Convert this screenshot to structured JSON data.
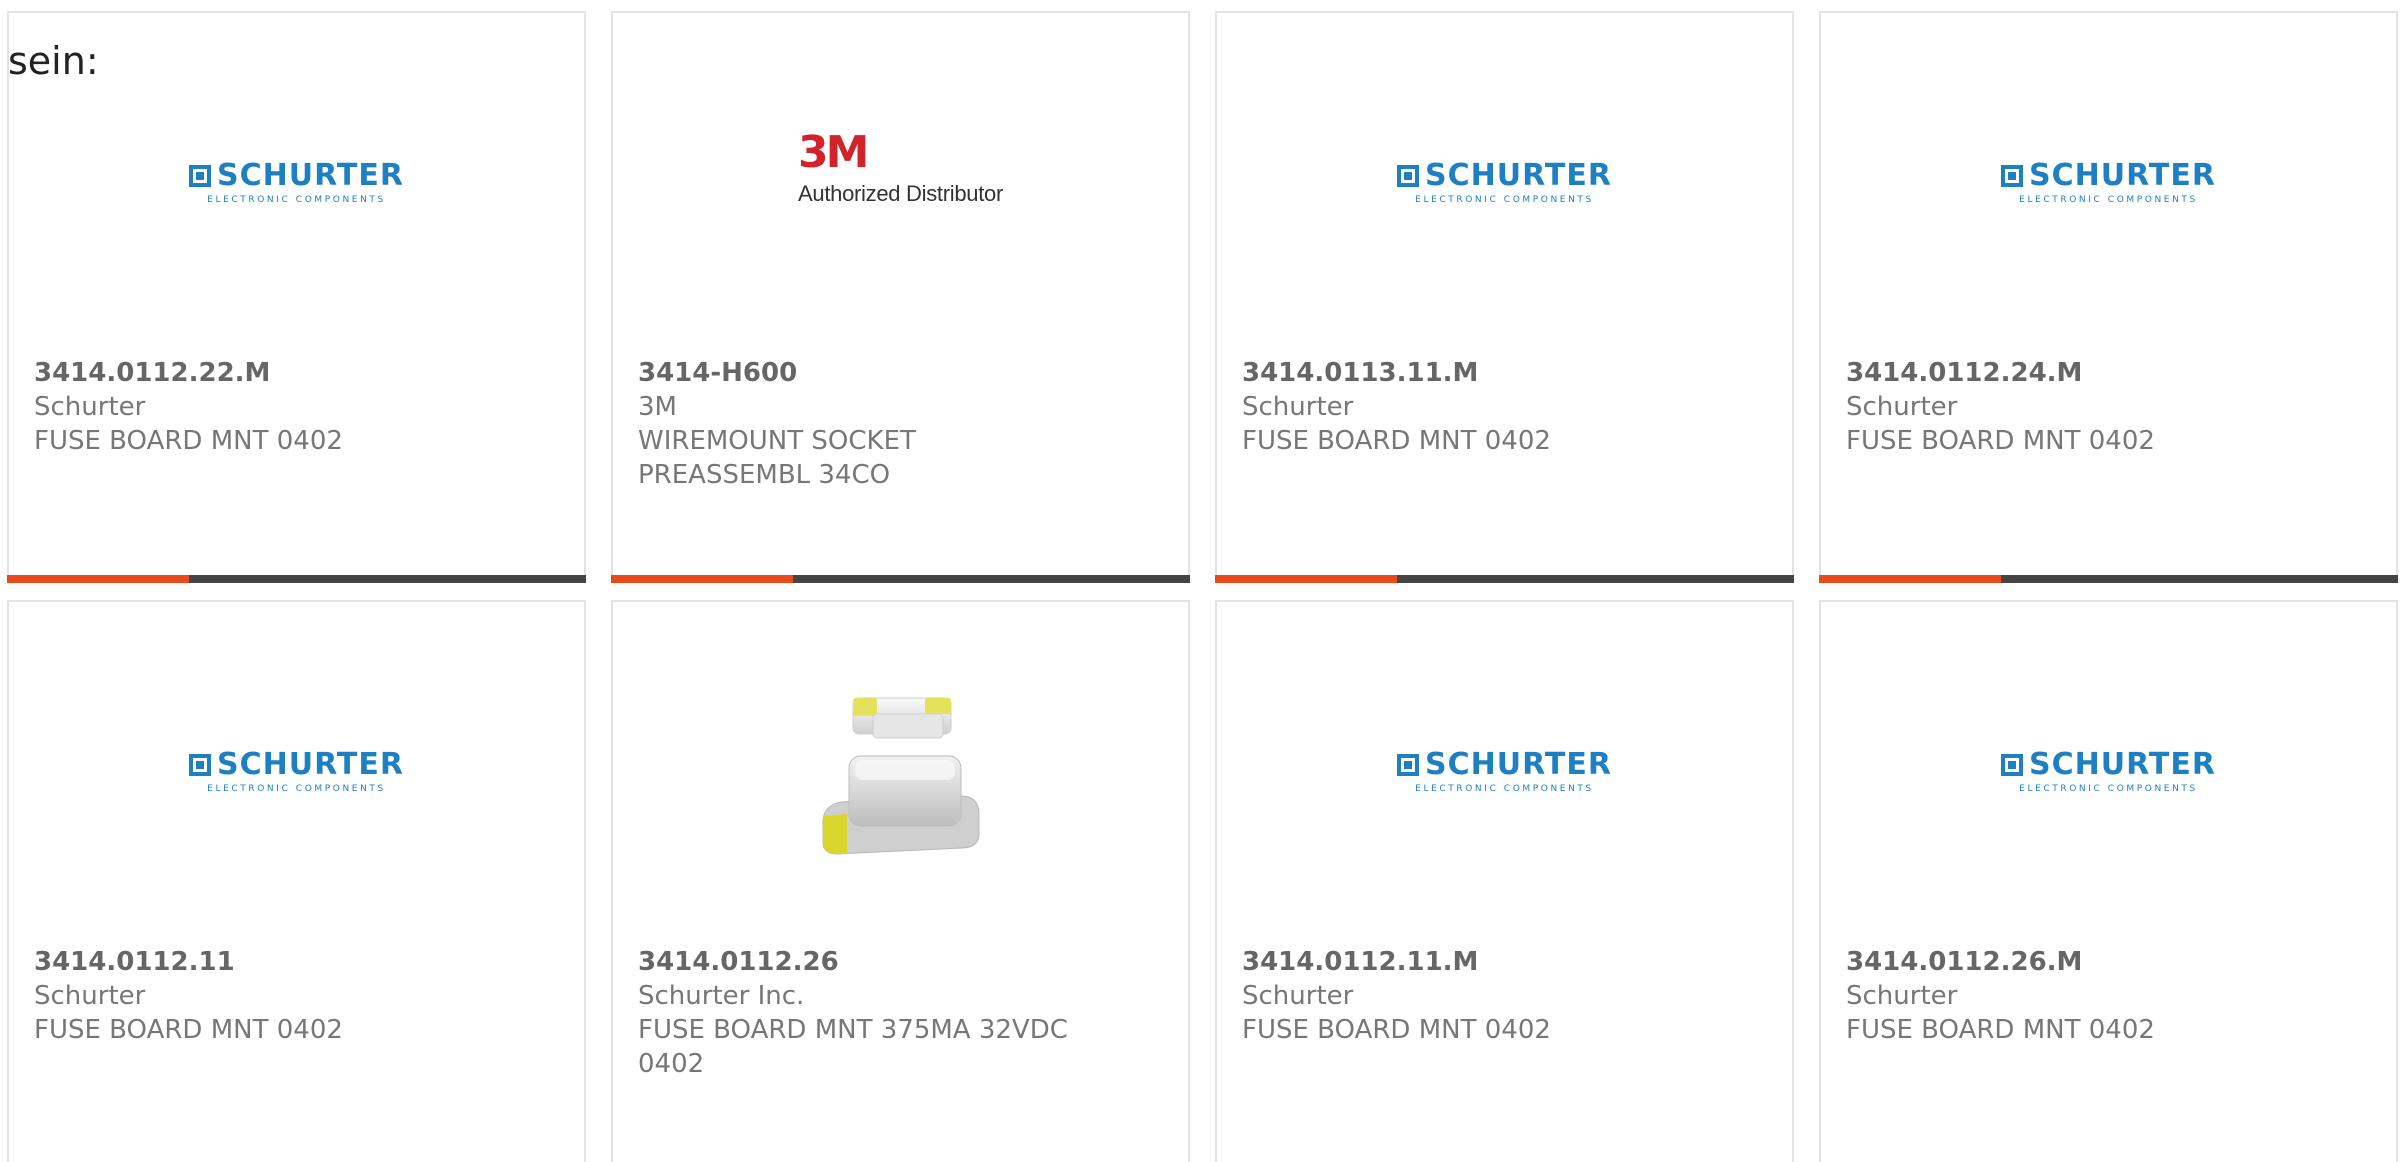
{
  "intro_text": "sein:",
  "accent_color": "#e84a1b",
  "bar_color": "#444444",
  "schurter_logo": {
    "word": "SCHURTER",
    "tagline": "ELECTRONIC COMPONENTS",
    "color": "#1e7fc3"
  },
  "m3_logo": {
    "mark": "3M",
    "subtitle": "Authorized Distributor",
    "color": "#d2232a"
  },
  "products": [
    {
      "part_number": "3414.0112.22.M",
      "manufacturer": "Schurter",
      "description": "FUSE BOARD MNT 0402",
      "image": "schurter-logo"
    },
    {
      "part_number": "3414-H600",
      "manufacturer": "3M",
      "description": "WIREMOUNT SOCKET PREASSEMBL 34CO",
      "image": "3m-logo"
    },
    {
      "part_number": "3414.0113.11.M",
      "manufacturer": "Schurter",
      "description": "FUSE BOARD MNT 0402",
      "image": "schurter-logo"
    },
    {
      "part_number": "3414.0112.24.M",
      "manufacturer": "Schurter",
      "description": "FUSE BOARD MNT 0402",
      "image": "schurter-logo"
    },
    {
      "part_number": "3414.0112.11",
      "manufacturer": "Schurter",
      "description": "FUSE BOARD MNT 0402",
      "image": "schurter-logo"
    },
    {
      "part_number": "3414.0112.26",
      "manufacturer": "Schurter Inc.",
      "description": "FUSE BOARD MNT 375MA 32VDC 0402",
      "image": "smd-fuse-photo"
    },
    {
      "part_number": "3414.0112.11.M",
      "manufacturer": "Schurter",
      "description": "FUSE BOARD MNT 0402",
      "image": "schurter-logo"
    },
    {
      "part_number": "3414.0112.26.M",
      "manufacturer": "Schurter",
      "description": "FUSE BOARD MNT 0402",
      "image": "schurter-logo"
    }
  ]
}
